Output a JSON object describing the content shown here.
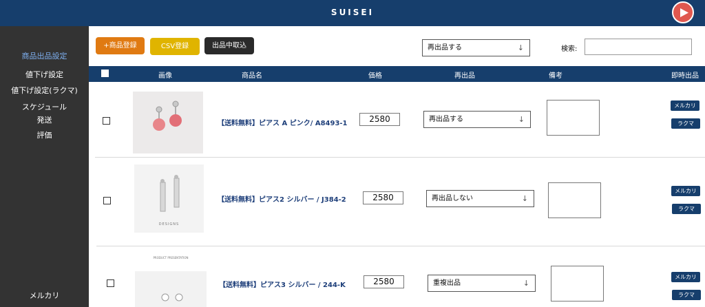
{
  "header": {
    "brand": "SUISEI",
    "play_icon": "play-icon"
  },
  "sidebar": {
    "items": [
      {
        "label": "商品出品設定",
        "active": true
      },
      {
        "label": "値下げ設定"
      },
      {
        "label": "値下げ設定(ラクマ)"
      },
      {
        "label": "スケジュール"
      },
      {
        "label": "発送"
      },
      {
        "label": "評価"
      }
    ],
    "bottom_label": "メルカリ"
  },
  "toolbar": {
    "add_label": "+商品登録",
    "csv_label": "CSV登録",
    "import_label": "出品中取込",
    "relist_select": "再出品する",
    "search_label": "検索:",
    "search_value": ""
  },
  "table": {
    "headers": {
      "image": "画像",
      "name": "商品名",
      "price": "価格",
      "relist": "再出品",
      "notes": "備考",
      "instant": "即時出品"
    },
    "rows": [
      {
        "name": "【送料無料】ピアス A ピンク/ A8493-1",
        "price": "2580",
        "relist": "再出品する",
        "mercari": "メルカリ",
        "rakuma": "ラクマ"
      },
      {
        "name": "【送料無料】ピアス2 シルバー / J384-2",
        "price": "2580",
        "relist": "再出品しない",
        "mercari": "メルカリ",
        "rakuma": "ラクマ",
        "image_caption": "DESIGNS"
      },
      {
        "name": "【送料無料】ピアス3 シルバー / 244-K",
        "price": "2580",
        "relist": "重複出品",
        "mercari": "メルカリ",
        "rakuma": "ラクマ",
        "image_caption": "PRODUCT PRESENTATION"
      }
    ]
  },
  "colors": {
    "navy": "#163e6c",
    "orange": "#e07a12",
    "yellow": "#e0b400",
    "dark": "#2a2a2a",
    "red": "#e0584f",
    "sidebar": "#333333",
    "active": "#7fb0f0"
  }
}
